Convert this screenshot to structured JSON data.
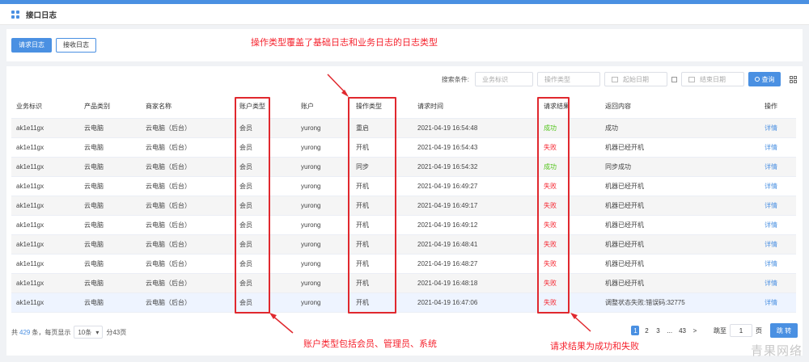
{
  "page_title": "接口日志",
  "tabs": [
    {
      "label": "请求日志",
      "active": true
    },
    {
      "label": "接收日志",
      "active": false
    }
  ],
  "search": {
    "label": "搜索条件:",
    "business_id_placeholder": "业务标识",
    "operation_type_placeholder": "操作类型",
    "start_date_placeholder": "起始日期",
    "end_date_placeholder": "结束日期",
    "query_label": "查询"
  },
  "table": {
    "headers": [
      "业务标识",
      "产品类别",
      "商家名称",
      "账户类型",
      "账户",
      "操作类型",
      "请求时间",
      "请求结果",
      "返回内容",
      "操作"
    ],
    "rows": [
      [
        "ak1e11gx",
        "云电脑",
        "云电脑（后台）",
        "会员",
        "yurong",
        "重启",
        "2021-04-19 16:54:48",
        "成功",
        "成功",
        "详情"
      ],
      [
        "ak1e11gx",
        "云电脑",
        "云电脑（后台）",
        "会员",
        "yurong",
        "开机",
        "2021-04-19 16:54:43",
        "失败",
        "机器已经开机",
        "详情"
      ],
      [
        "ak1e11gx",
        "云电脑",
        "云电脑（后台）",
        "会员",
        "yurong",
        "同步",
        "2021-04-19 16:54:32",
        "成功",
        "同步成功",
        "详情"
      ],
      [
        "ak1e11gx",
        "云电脑",
        "云电脑（后台）",
        "会员",
        "yurong",
        "开机",
        "2021-04-19 16:49:27",
        "失败",
        "机器已经开机",
        "详情"
      ],
      [
        "ak1e11gx",
        "云电脑",
        "云电脑（后台）",
        "会员",
        "yurong",
        "开机",
        "2021-04-19 16:49:17",
        "失败",
        "机器已经开机",
        "详情"
      ],
      [
        "ak1e11gx",
        "云电脑",
        "云电脑（后台）",
        "会员",
        "yurong",
        "开机",
        "2021-04-19 16:49:12",
        "失败",
        "机器已经开机",
        "详情"
      ],
      [
        "ak1e11gx",
        "云电脑",
        "云电脑（后台）",
        "会员",
        "yurong",
        "开机",
        "2021-04-19 16:48:41",
        "失败",
        "机器已经开机",
        "详情"
      ],
      [
        "ak1e11gx",
        "云电脑",
        "云电脑（后台）",
        "会员",
        "yurong",
        "开机",
        "2021-04-19 16:48:27",
        "失败",
        "机器已经开机",
        "详情"
      ],
      [
        "ak1e11gx",
        "云电脑",
        "云电脑（后台）",
        "会员",
        "yurong",
        "开机",
        "2021-04-19 16:48:18",
        "失败",
        "机器已经开机",
        "详情"
      ],
      [
        "ak1e11gx",
        "云电脑",
        "云电脑（后台）",
        "会员",
        "yurong",
        "开机",
        "2021-04-19 16:47:06",
        "失败",
        "调整状态失败:错误码:32775",
        "详情"
      ]
    ]
  },
  "pagination": {
    "total_prefix": "共",
    "total": "429",
    "total_suffix": "条，每页显示",
    "page_size": "10条",
    "pages_text": "分43页",
    "pages": [
      "1",
      "2",
      "3",
      "...",
      "43",
      ">"
    ],
    "current_page": "1",
    "jump_label": "跳至",
    "jump_value": "1",
    "page_unit": "页",
    "jump_button": "跳 转"
  },
  "annotations": {
    "operation_type": "操作类型覆盖了基础日志和业务日志的日志类型",
    "account_type": "账户类型包括会员、管理员、系统",
    "request_result": "请求结果为成功和失败"
  },
  "watermark": "青果网络",
  "colors": {
    "primary": "#4a90e2",
    "success": "#52c41a",
    "fail": "#f5222d",
    "annotation": "#e0282e"
  }
}
